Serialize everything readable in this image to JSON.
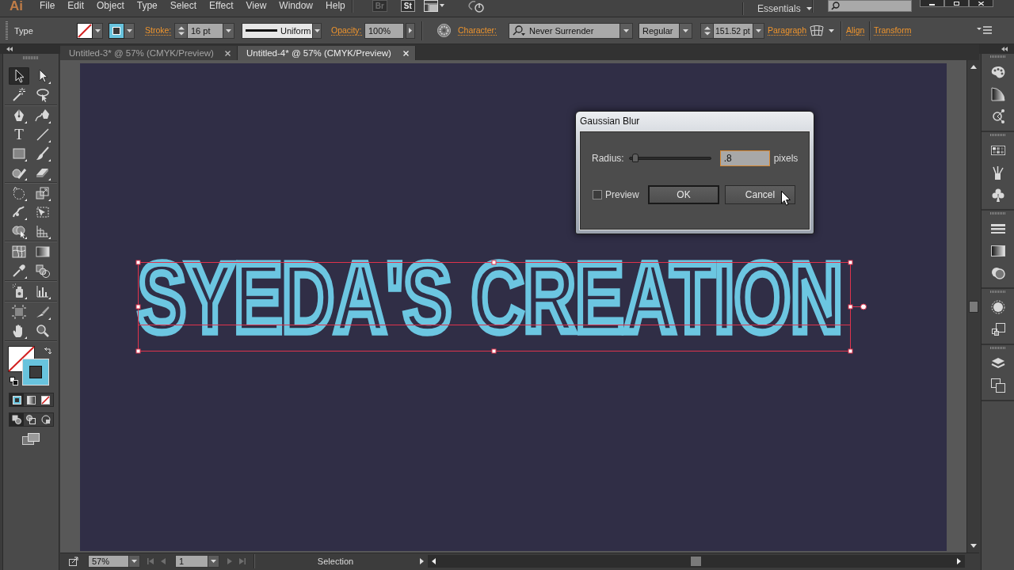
{
  "menu_bar": {
    "logo": "Ai",
    "menus": [
      "File",
      "Edit",
      "Object",
      "Type",
      "Select",
      "Effect",
      "View",
      "Window",
      "Help"
    ],
    "app_buttons": [
      {
        "label": "Br",
        "dimmed": true
      },
      {
        "label": "St",
        "dimmed": false
      }
    ],
    "workspace": "Essentials"
  },
  "control_bar": {
    "selection_type": "Type",
    "stroke_label": "Stroke:",
    "stroke_weight": "16 pt",
    "profile": "Uniform",
    "opacity_label": "Opacity:",
    "opacity": "100%",
    "character_label": "Character:",
    "font": "Never Surrender",
    "font_style": "Regular",
    "font_size": "151.52 pt",
    "paragraph_label": "Paragraph",
    "align_label": "Align",
    "transform_label": "Transform"
  },
  "tabs": [
    {
      "label": "Untitled-3* @ 57% (CMYK/Preview)",
      "selected": false
    },
    {
      "label": "Untitled-4* @ 57% (CMYK/Preview)",
      "selected": true
    }
  ],
  "tools_panel": {
    "tool_groups": [
      {
        "tools": [
          {
            "kind": "selection",
            "selected": true
          },
          {
            "kind": "direct",
            "selected": false
          },
          {
            "kind": "wand",
            "selected": false
          },
          {
            "kind": "lasso",
            "selected": false
          }
        ]
      },
      {
        "tools": [
          {
            "kind": "pen",
            "selected": false
          },
          {
            "kind": "curvature",
            "selected": false
          },
          {
            "kind": "type",
            "symbol": "T",
            "selected": false
          },
          {
            "kind": "line",
            "selected": false
          },
          {
            "kind": "rectangle",
            "selected": false
          },
          {
            "kind": "brush",
            "selected": false
          },
          {
            "kind": "shaper",
            "selected": false
          },
          {
            "kind": "eraser",
            "selected": false
          }
        ]
      },
      {
        "tools": [
          {
            "kind": "rotate",
            "selected": false
          },
          {
            "kind": "scale",
            "selected": false
          },
          {
            "kind": "warp",
            "selected": false
          },
          {
            "kind": "transform",
            "selected": false
          },
          {
            "kind": "builder",
            "selected": false
          },
          {
            "kind": "perspective",
            "selected": false
          }
        ]
      },
      {
        "tools": [
          {
            "kind": "mesh",
            "selected": false
          },
          {
            "kind": "gradient",
            "selected": false
          },
          {
            "kind": "eyedropper",
            "selected": false
          },
          {
            "kind": "blend",
            "selected": false
          }
        ]
      },
      {
        "tools": [
          {
            "kind": "sprayer",
            "selected": false
          },
          {
            "kind": "graph",
            "selected": false
          }
        ]
      },
      {
        "tools": [
          {
            "kind": "artboard",
            "selected": false
          },
          {
            "kind": "slice",
            "selected": false
          },
          {
            "kind": "hand",
            "selected": false
          },
          {
            "kind": "zoom",
            "selected": false
          }
        ]
      }
    ],
    "color_modes": [
      {
        "kind": "color",
        "selected": true
      },
      {
        "kind": "gradient",
        "selected": false
      },
      {
        "kind": "none",
        "selected": false
      }
    ],
    "draw_modes": [
      {
        "kind": "normal",
        "selected": true
      },
      {
        "kind": "behind",
        "selected": false
      },
      {
        "kind": "inside",
        "selected": false
      }
    ]
  },
  "canvas": {
    "text": "SYEDA'S CREATION",
    "selected": true
  },
  "dialog": {
    "title": "Gaussian Blur",
    "radius_label": "Radius:",
    "radius": {
      "level": 0.04
    },
    "radius_value": ".8",
    "unit": "pixels",
    "preview": {
      "label": "Preview",
      "checked": false
    },
    "buttons": [
      {
        "label": "OK",
        "default": true
      },
      {
        "label": "Cancel",
        "default": false
      }
    ]
  },
  "status_bar": {
    "zoom": "57%",
    "artboard": "1",
    "status": "Selection"
  }
}
